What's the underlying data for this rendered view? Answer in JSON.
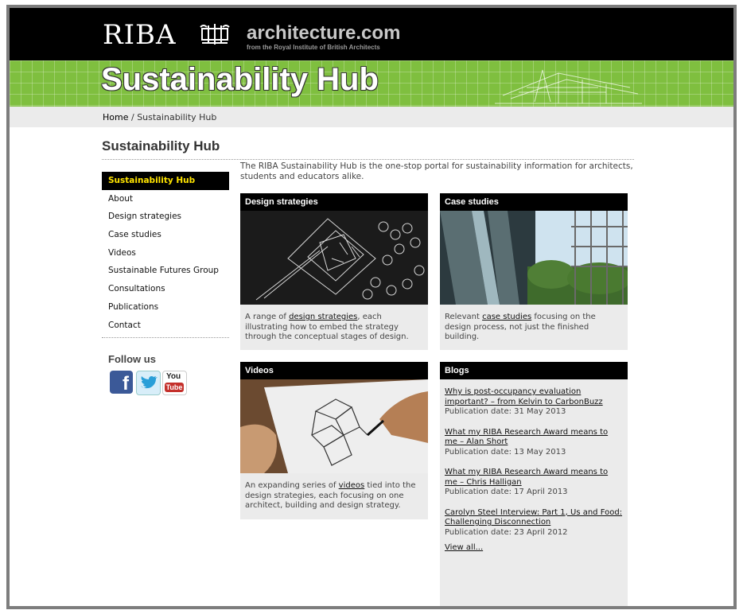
{
  "header": {
    "riba": "RIBA",
    "site_title": "architecture.com",
    "site_subtitle": "from the Royal Institute of British Architects"
  },
  "banner": {
    "title": "Sustainability Hub"
  },
  "breadcrumb": {
    "home": "Home",
    "separator": " / ",
    "current": "Sustainability Hub"
  },
  "page_title": "Sustainability Hub",
  "intro": "The RIBA Sustainability Hub is the one-stop portal for sustainability information for architects, students and educators alike.",
  "sidebar": {
    "items": [
      {
        "label": "Sustainability Hub"
      },
      {
        "label": "About"
      },
      {
        "label": "Design strategies"
      },
      {
        "label": "Case studies"
      },
      {
        "label": "Videos"
      },
      {
        "label": "Sustainable Futures Group"
      },
      {
        "label": "Consultations"
      },
      {
        "label": "Publications"
      },
      {
        "label": "Contact"
      }
    ],
    "follow_label": "Follow us",
    "social": {
      "facebook": "f",
      "youtube_top": "You",
      "youtube_bottom": "Tube"
    }
  },
  "panels": {
    "design": {
      "title": "Design strategies",
      "text_before": "A range of ",
      "link": "design strategies",
      "text_after": ", each illustrating how to embed the strategy through the conceptual stages of design."
    },
    "case": {
      "title": "Case studies",
      "text_before": "Relevant ",
      "link": "case studies",
      "text_after": " focusing on the design process, not just the finished building."
    },
    "videos": {
      "title": "Videos",
      "text_before": "An expanding series of ",
      "link": "videos",
      "text_after": " tied into the design strategies, each focusing on one architect, building and design strategy."
    },
    "blogs": {
      "title": "Blogs",
      "items": [
        {
          "title": "Why is post-occupancy evaluation important? – from Kelvin to CarbonBuzz ",
          "date": "Publication date: 31 May 2013"
        },
        {
          "title": "What my RIBA Research Award means to me – Alan Short ",
          "date": "Publication date: 13 May 2013"
        },
        {
          "title": "What my RIBA Research Award means to me – Chris Halligan ",
          "date": "Publication date: 17 April 2013"
        },
        {
          "title": "Carolyn Steel Interview: Part 1, Us and Food: Challenging Disconnection ",
          "date": "Publication date: 23 April 2012"
        }
      ],
      "view_all": "View all..."
    }
  },
  "colors": {
    "banner_green": "#7fbf3f",
    "active_nav_text": "#ffe400",
    "header_black": "#000000"
  }
}
